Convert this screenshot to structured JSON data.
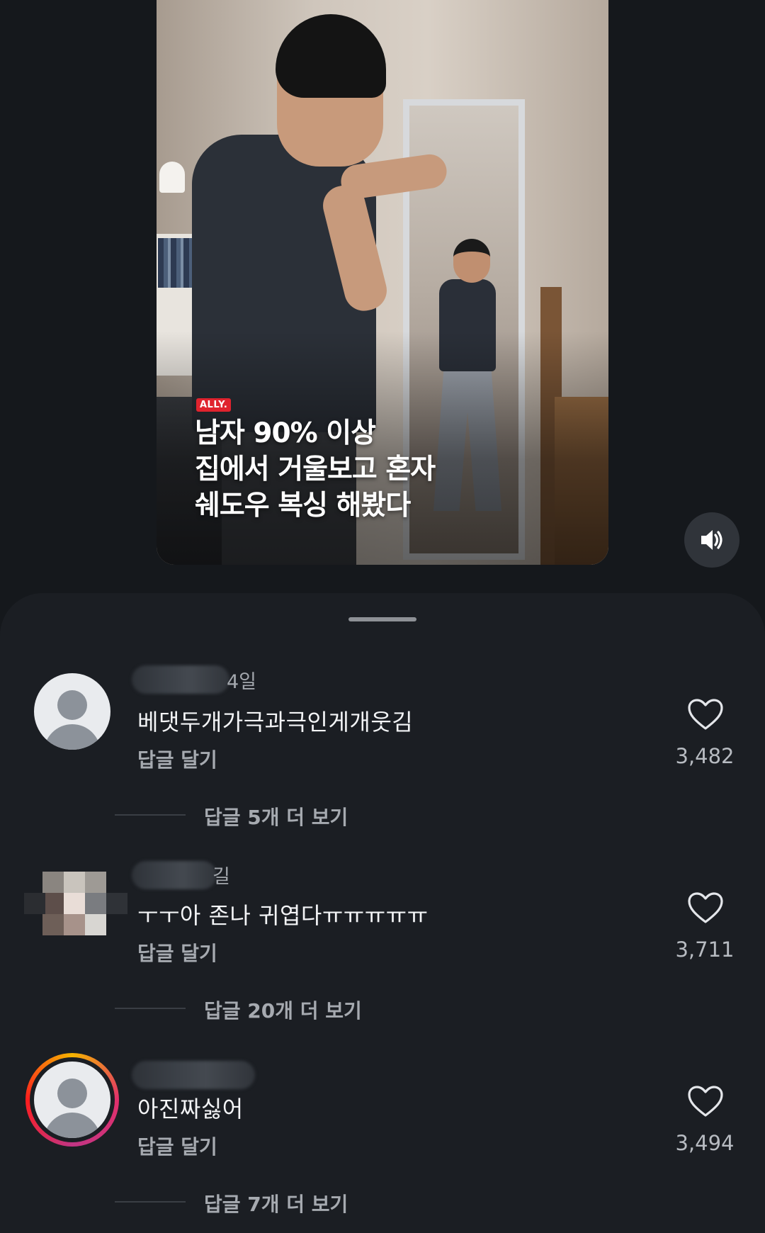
{
  "video": {
    "badge": "ALLY.",
    "caption_lines": [
      "남자 90% 이상",
      "집에서 거울보고 혼자",
      "쉐도우 복싱 해봤다"
    ],
    "volume_icon": "speaker-icon"
  },
  "comments": [
    {
      "time": "4일",
      "text": "베댓두개가극과극인게개웃김",
      "reply_label": "답글 달기",
      "likes": "3,482",
      "more_replies": "답글 5개 더 보기"
    },
    {
      "time": "길",
      "text": "ㅜㅜ아 존나 귀엽다ㅠㅠㅠㅠㅠ",
      "reply_label": "답글 달기",
      "likes": "3,711",
      "more_replies": "답글 20개 더 보기"
    },
    {
      "time": "",
      "text": "아진짜싫어",
      "reply_label": "답글 달기",
      "likes": "3,494",
      "more_replies": "답글 7개 더 보기"
    }
  ],
  "colors": {
    "background": "#15181c",
    "sheet": "#1b1e23",
    "badge": "#e0232e"
  }
}
